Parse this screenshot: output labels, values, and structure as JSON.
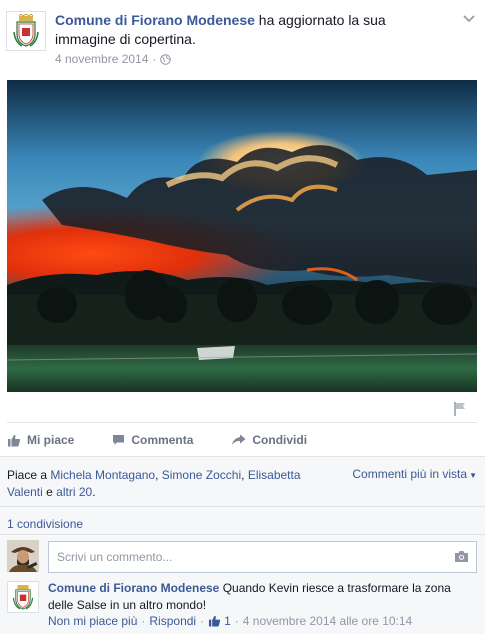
{
  "post": {
    "author": "Comune di Fiorano Modenese",
    "action_text": " ha aggiornato la sua immagine di copertina.",
    "date": "4 novembre 2014",
    "separator": "·",
    "privacy_icon": "globe-icon",
    "menu_icon": "chevron-down-icon",
    "photo_description_icon": "cover-photo"
  },
  "actions": {
    "like_label": "Mi piace",
    "comment_label": "Commenta",
    "share_label": "Condividi"
  },
  "feedback": {
    "likes_prefix": "Piace a ",
    "liker_1": "Michela Montagano",
    "comma_1": ", ",
    "liker_2": "Simone Zocchi",
    "comma_2": ", ",
    "liker_3": "Elisabetta Valenti",
    "and_text": " e ",
    "others": "altri 20",
    "end": ".",
    "sort_label": "Commenti più in vista",
    "shares": "1 condivisione",
    "comment_placeholder": "Scrivi un commento..."
  },
  "comment": {
    "author": "Comune di Fiorano Modenese",
    "text": " Quando Kevin riesce a trasformare la zona delle Salse in un altro mondo!",
    "unlike": "Non mi piace più",
    "dot_1": "·",
    "reply": "Rispondi",
    "dot_2": "·",
    "like_count": "1",
    "dot_3": "·",
    "timestamp": "4 novembre 2014 alle ore 10:14"
  },
  "colors": {
    "link": "#3b5998",
    "muted": "#9197a3",
    "feedback_bg": "#f6f7f9"
  }
}
